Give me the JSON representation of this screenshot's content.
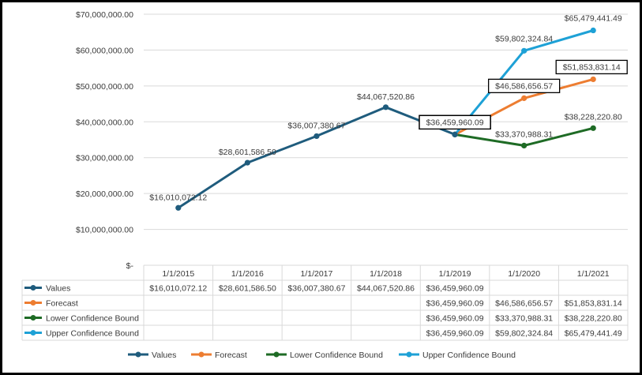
{
  "chart_data": {
    "type": "line",
    "title": "",
    "xlabel": "",
    "ylabel": "",
    "ylim": [
      0,
      70000000
    ],
    "y_ticks": [
      "$-",
      "$10,000,000.00",
      "$20,000,000.00",
      "$30,000,000.00",
      "$40,000,000.00",
      "$50,000,000.00",
      "$60,000,000.00",
      "$70,000,000.00"
    ],
    "grid": true,
    "legend_position": "bottom",
    "categories": [
      "1/1/2015",
      "1/1/2016",
      "1/1/2017",
      "1/1/2018",
      "1/1/2019",
      "1/1/2020",
      "1/1/2021"
    ],
    "series": [
      {
        "name": "Values",
        "color": "#1f5c7d",
        "values": [
          16010072.12,
          28601586.5,
          36007380.67,
          44067520.86,
          36459960.09,
          null,
          null
        ],
        "labels": [
          "$16,010,072.12",
          "$28,601,586.50",
          "$36,007,380.67",
          "$44,067,520.86",
          "$36,459,960.09",
          "",
          ""
        ]
      },
      {
        "name": "Forecast",
        "color": "#ed7d31",
        "values": [
          null,
          null,
          null,
          null,
          36459960.09,
          46586656.57,
          51853831.14
        ],
        "labels": [
          "",
          "",
          "",
          "",
          "$36,459,960.09",
          "$46,586,656.57",
          "$51,853,831.14"
        ]
      },
      {
        "name": "Lower Confidence Bound",
        "color": "#1e6b25",
        "values": [
          null,
          null,
          null,
          null,
          36459960.09,
          33370988.31,
          38228220.8
        ],
        "labels": [
          "",
          "",
          "",
          "",
          "$36,459,960.09",
          "$33,370,988.31",
          "$38,228,220.80"
        ]
      },
      {
        "name": "Upper Confidence Bound",
        "color": "#1ea1d6",
        "values": [
          null,
          null,
          null,
          null,
          36459960.09,
          59802324.84,
          65479441.49
        ],
        "labels": [
          "",
          "",
          "",
          "",
          "$36,459,960.09",
          "$59,802,324.84",
          "$65,479,441.49"
        ]
      }
    ]
  }
}
